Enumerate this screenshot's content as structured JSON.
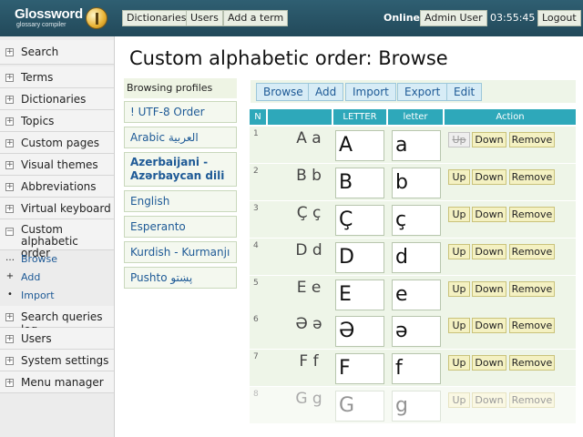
{
  "header": {
    "logo_title": "Glossword",
    "logo_subtitle": "glossary compiler",
    "nav": [
      "Dictionaries",
      "Users",
      "Add a term"
    ],
    "status": "Online",
    "user": "Admin User",
    "time": "03:55:45",
    "logout": "Logout"
  },
  "sidebar": {
    "items": [
      {
        "label": "Search",
        "toggle": "+"
      },
      {
        "label": "Terms",
        "toggle": "+"
      },
      {
        "label": "Dictionaries",
        "toggle": "+"
      },
      {
        "label": "Topics",
        "toggle": "+"
      },
      {
        "label": "Custom pages",
        "toggle": "+"
      },
      {
        "label": "Visual themes",
        "toggle": "+"
      },
      {
        "label": "Abbreviations",
        "toggle": "+"
      },
      {
        "label": "Virtual keyboard",
        "toggle": "+"
      },
      {
        "label": "Custom alphabetic order",
        "toggle": "−"
      },
      {
        "label": "Search queries log",
        "toggle": "+"
      },
      {
        "label": "Users",
        "toggle": "+"
      },
      {
        "label": "System settings",
        "toggle": "+"
      },
      {
        "label": "Menu manager",
        "toggle": "+"
      }
    ],
    "subitems": [
      {
        "label": "Browse",
        "bullet": "…"
      },
      {
        "label": "Add",
        "bullet": "+"
      },
      {
        "label": "Import",
        "bullet": "•"
      }
    ]
  },
  "page_title": "Custom alphabetic order: Browse",
  "profiles": {
    "heading": "Browsing profiles",
    "items": [
      {
        "label": "! UTF-8 Order"
      },
      {
        "label": "Arabic العربية"
      },
      {
        "label": "Azerbaijani - Azərbaycan dili"
      },
      {
        "label": "English"
      },
      {
        "label": "Esperanto"
      },
      {
        "label": "Kurdish - Kurmanjı"
      },
      {
        "label": "Pushto پښتو"
      }
    ]
  },
  "toolbar": [
    "Browse",
    "Add",
    "Import",
    "Export",
    "Edit"
  ],
  "table": {
    "headers": {
      "n": "N",
      "upper": "LETTER",
      "lower": "letter",
      "action": "Action"
    },
    "actions": {
      "up": "Up",
      "down": "Down",
      "remove": "Remove"
    },
    "rows": [
      {
        "n": "1",
        "pair": "A a",
        "upper": "A",
        "lower": "a"
      },
      {
        "n": "2",
        "pair": "B b",
        "upper": "B",
        "lower": "b"
      },
      {
        "n": "3",
        "pair": "Ç ç",
        "upper": "Ç",
        "lower": "ç"
      },
      {
        "n": "4",
        "pair": "D d",
        "upper": "D",
        "lower": "d"
      },
      {
        "n": "5",
        "pair": "E e",
        "upper": "E",
        "lower": "e"
      },
      {
        "n": "6",
        "pair": "Ə ə",
        "upper": "Ə",
        "lower": "ə"
      },
      {
        "n": "7",
        "pair": "F f",
        "upper": "F",
        "lower": "f"
      },
      {
        "n": "8",
        "pair": "G g",
        "upper": "G",
        "lower": "g"
      }
    ]
  },
  "colors": {
    "header_bg": "#22495a",
    "table_header": "#2ea8ba",
    "link": "#1e5a96",
    "row_bg": "#eef5e8",
    "action_btn": "#f4f1c2"
  }
}
